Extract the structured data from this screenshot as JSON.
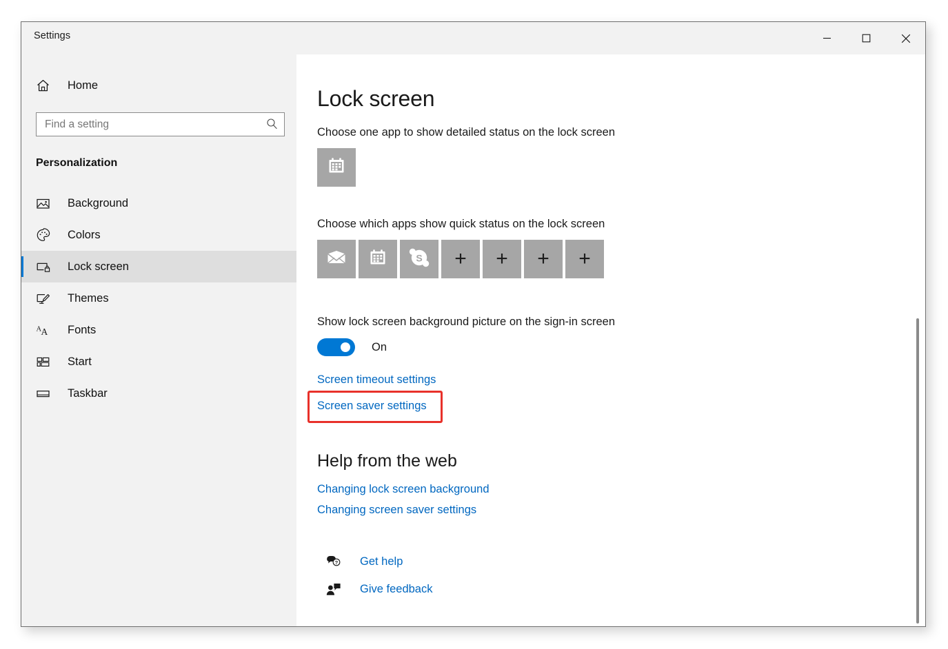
{
  "window": {
    "title": "Settings",
    "controls": [
      {
        "name": "minimize",
        "glyph": "minimize-icon",
        "label": "Minimize"
      },
      {
        "name": "maximize",
        "glyph": "maximize-icon",
        "label": "Maximize"
      },
      {
        "name": "close",
        "glyph": "close-icon",
        "label": "Close"
      }
    ]
  },
  "sidebar": {
    "home_label": "Home",
    "home_icon": "home-icon",
    "search": {
      "placeholder": "Find a setting",
      "value": "",
      "icon": "search-icon"
    },
    "group_title": "Personalization",
    "items": [
      {
        "label": "Background",
        "icon": "image-icon",
        "selected": false
      },
      {
        "label": "Colors",
        "icon": "palette-icon",
        "selected": false
      },
      {
        "label": "Lock screen",
        "icon": "lock-screen-icon",
        "selected": true
      },
      {
        "label": "Themes",
        "icon": "theme-brush-icon",
        "selected": false
      },
      {
        "label": "Fonts",
        "icon": "fonts-aa-icon",
        "selected": false
      },
      {
        "label": "Start",
        "icon": "start-tiles-icon",
        "selected": false
      },
      {
        "label": "Taskbar",
        "icon": "taskbar-icon",
        "selected": false
      }
    ]
  },
  "main": {
    "page_title": "Lock screen",
    "detailed_status": {
      "label": "Choose one app to show detailed status on the lock screen",
      "tiles": [
        {
          "app": "Calendar",
          "icon": "calendar-icon",
          "type": "app"
        }
      ]
    },
    "quick_status": {
      "label": "Choose which apps show quick status on the lock screen",
      "tiles": [
        {
          "app": "Mail",
          "icon": "mail-envelope-icon",
          "type": "app"
        },
        {
          "app": "Calendar",
          "icon": "calendar-icon",
          "type": "app"
        },
        {
          "app": "Skype",
          "icon": "skype-icon",
          "type": "app"
        },
        {
          "app": "Add",
          "icon": "plus-icon",
          "type": "add",
          "glyph": "+"
        },
        {
          "app": "Add",
          "icon": "plus-icon",
          "type": "add",
          "glyph": "+"
        },
        {
          "app": "Add",
          "icon": "plus-icon",
          "type": "add",
          "glyph": "+"
        },
        {
          "app": "Add",
          "icon": "plus-icon",
          "type": "add",
          "glyph": "+"
        }
      ]
    },
    "signin_background": {
      "label": "Show lock screen background picture on the sign-in screen",
      "toggle_state": "On",
      "toggle_on": true
    },
    "links": {
      "screen_timeout": "Screen timeout settings",
      "screen_saver": "Screen saver settings"
    },
    "help": {
      "title": "Help from the web",
      "links": [
        "Changing lock screen background",
        "Changing screen saver settings"
      ],
      "actions": [
        {
          "label": "Get help",
          "icon": "get-help-icon"
        },
        {
          "label": "Give feedback",
          "icon": "give-feedback-icon"
        }
      ]
    }
  },
  "annotation": {
    "highlight_target": "Screen saver settings",
    "highlight_color": "#e8312a"
  },
  "colors": {
    "accent": "#0078d4",
    "link": "#0067c0",
    "sidebar_bg": "#f2f2f2",
    "tile_bg": "#a6a6a6",
    "highlight": "#e8312a"
  }
}
